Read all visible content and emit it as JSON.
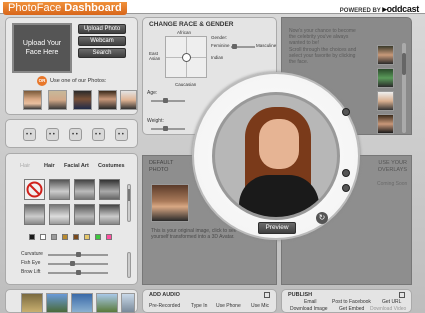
{
  "header": {
    "app_name": "PhotoFace",
    "app_section": "Dashboard",
    "powered_by": "POWERED BY",
    "logo_text": "oddcast"
  },
  "upload": {
    "box_label": "Upload Your Face Here",
    "buttons": [
      "Upload Photo",
      "Webcam",
      "Search"
    ],
    "or_badge": "OR",
    "or_text": "Use one of our Photos:",
    "photos": [
      "woman-photo",
      "man-photo",
      "obama-photo",
      "man2-photo",
      "clinton-photo"
    ]
  },
  "emotions": [
    "neutral-face-icon",
    "sad-face-icon",
    "frown-face-icon",
    "surprised-face-icon",
    "smile-face-icon"
  ],
  "customize": {
    "tabs": [
      "Hair",
      "Hair",
      "Facial Art",
      "Costumes"
    ],
    "swatch_colors": [
      "#1a1a1a",
      "#ffffff",
      "#9a9a9a",
      "#b98a2e",
      "#7a4a1c",
      "#e6c86a",
      "#3ec83e",
      "#ff4fa0"
    ],
    "sliders": [
      {
        "label": "Curvature",
        "value": 0.5
      },
      {
        "label": "Fish Eye",
        "value": 0.4
      },
      {
        "label": "Brow Lift",
        "value": 0.5
      }
    ]
  },
  "race": {
    "title": "CHANGE RACE & GENDER",
    "labels": {
      "african": "African",
      "east_asian": "East Asian",
      "indian": "Indian",
      "caucasian": "Caucasian",
      "gender": "Gender:",
      "feminine": "Feminine",
      "masculine": "Masculine"
    },
    "age_label": "Age:",
    "weight_label": "Weight:"
  },
  "tips": {
    "text1": "Now's your chance to become the celebrity you've always wanted to be!",
    "text2": "Scroll through the choices and select your favorite by clicking the face."
  },
  "default_photo": {
    "title": "DEFAULT PHOTO",
    "text": "This is your original image, click to see yourself transformed into a 3D Avatar."
  },
  "use_overlay": {
    "title": "USE YOUR OVERLAYS",
    "subtitle": "Coming Soon"
  },
  "preview": {
    "button_label": "Preview"
  },
  "audio": {
    "title": "ADD AUDIO",
    "options": [
      "Pre-Recorded",
      "Type In",
      "Use Phone",
      "Use Mic"
    ]
  },
  "publish": {
    "title": "PUBLISH",
    "row1": [
      "Email",
      "Post to Facebook",
      "Get URL"
    ],
    "row2": [
      "Download Image",
      "Get Embed",
      "Download Video"
    ]
  }
}
